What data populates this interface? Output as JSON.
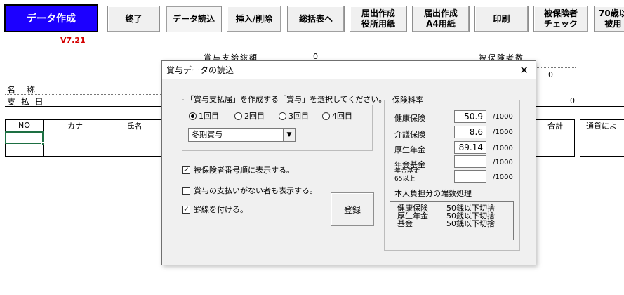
{
  "toolbar": {
    "primary": "データ作成",
    "version": "V7.21",
    "buttons": [
      {
        "label": "終了"
      },
      {
        "label": "データ読込"
      },
      {
        "label": "挿入/削除"
      },
      {
        "label": "総括表へ"
      },
      {
        "label": "届出作成\n役所用紙"
      },
      {
        "label": "届出作成\nA4用紙"
      },
      {
        "label": "印刷"
      },
      {
        "label": "被保険者\nチェック"
      },
      {
        "label": "70歳以\n被用"
      }
    ]
  },
  "sheet": {
    "label_name": "名　称",
    "label_payday": "支 払 日",
    "partial_top_left": "賞与支給総額",
    "partial_top_right": "被保険者数",
    "value_zero_a": "0",
    "value_zero_b": "0",
    "value_zero_c": "0",
    "columns": [
      "NO",
      "カナ",
      "氏名",
      "合計",
      "通貨によ"
    ]
  },
  "dialog": {
    "title": "賞与データの読込",
    "close_glyph": "✕",
    "select_group_label": "「賞与支払届」を作成する「賞与」を選択してください。",
    "radios": [
      {
        "label": "1回目",
        "selected": true
      },
      {
        "label": "2回目",
        "selected": false
      },
      {
        "label": "3回目",
        "selected": false
      },
      {
        "label": "4回目",
        "selected": false
      }
    ],
    "combo_value": "冬期賞与",
    "combo_arrow": "▼",
    "checks": [
      {
        "label": "被保険者番号順に表示する。",
        "checked": true,
        "mark": "✓"
      },
      {
        "label": "賞与の支払いがない者も表示する。",
        "checked": false,
        "mark": ""
      },
      {
        "label": "罫線を付ける。",
        "checked": true,
        "mark": "✓"
      }
    ],
    "register_button": "登録",
    "rate_group_label": "保険料率",
    "rates": [
      {
        "label": "健康保険",
        "value": "50.9",
        "unit": "/1000"
      },
      {
        "label": "介護保険",
        "value": "8.6",
        "unit": "/1000"
      },
      {
        "label": "厚生年金",
        "value": "89.14",
        "unit": "/1000"
      },
      {
        "label": "年金基金",
        "value": "",
        "unit": "/1000"
      },
      {
        "label": "年金基金\n65以上",
        "value": "",
        "unit": "/1000"
      }
    ],
    "fraction_title": "本人負担分の端数処理",
    "fractions": [
      {
        "label": "健康保険",
        "rule": "50銭以下切捨"
      },
      {
        "label": "厚生年金",
        "rule": "50銭以下切捨"
      },
      {
        "label": "基金",
        "rule": "50銭以下切捨"
      }
    ]
  }
}
